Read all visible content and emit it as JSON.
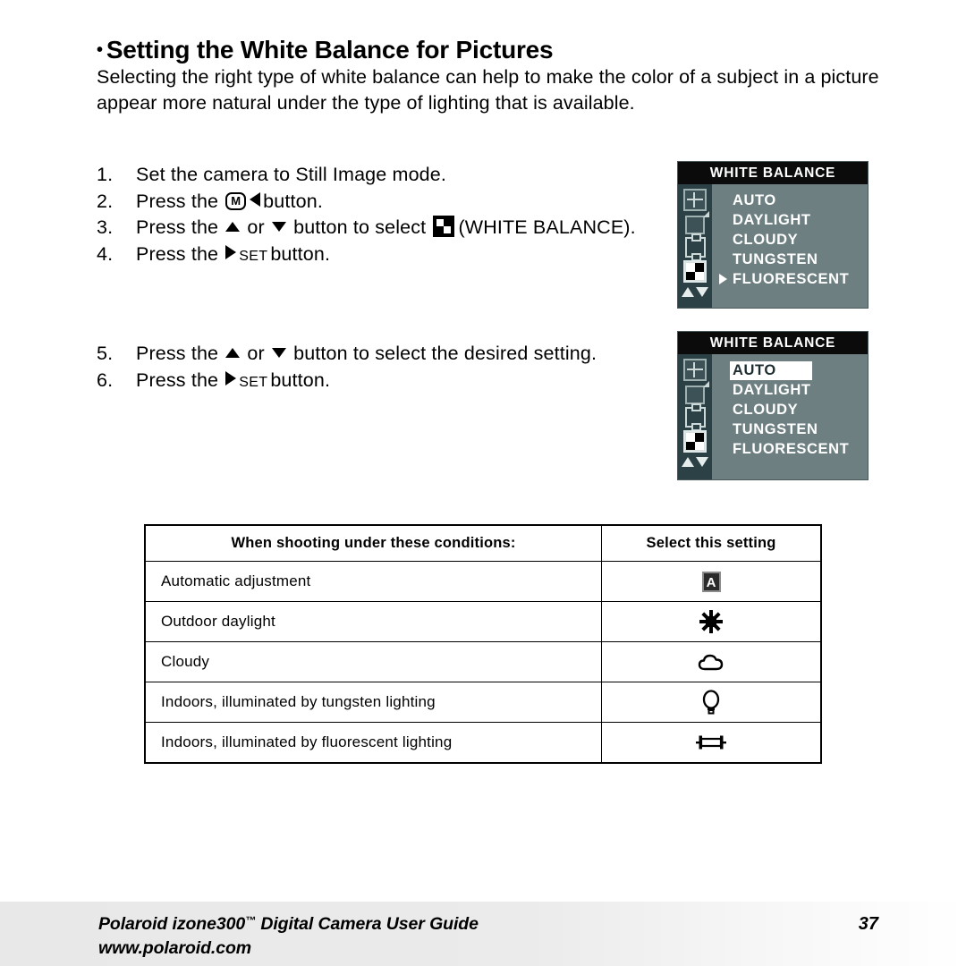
{
  "heading": {
    "bullet": "•",
    "text": "Setting the White Balance for Pictures"
  },
  "intro": "Selecting the right type of white balance can help to make the color of a subject in a picture appear more natural under the type of lighting that is available.",
  "steps_group_a": [
    {
      "num": "1.",
      "parts": [
        {
          "type": "text",
          "text": "Set the camera to Still Image mode."
        }
      ]
    },
    {
      "num": "2.",
      "parts": [
        {
          "type": "text",
          "text": "Press the "
        },
        {
          "type": "btn-m",
          "text": "M"
        },
        {
          "type": "tri-left"
        },
        {
          "type": "text",
          "text": "button."
        }
      ]
    },
    {
      "num": "3.",
      "parts": [
        {
          "type": "text",
          "text": "Press the "
        },
        {
          "type": "tri-up"
        },
        {
          "type": "text",
          "text": " or "
        },
        {
          "type": "tri-down"
        },
        {
          "type": "text",
          "text": " button to select "
        },
        {
          "type": "wb-icon"
        },
        {
          "type": "text",
          "text": "(WHITE BALANCE)."
        }
      ]
    },
    {
      "num": "4.",
      "parts": [
        {
          "type": "text",
          "text": "Press the "
        },
        {
          "type": "tri-right"
        },
        {
          "type": "set",
          "text": "SET"
        },
        {
          "type": "text",
          "text": "button."
        }
      ]
    }
  ],
  "steps_group_b": [
    {
      "num": "5.",
      "parts": [
        {
          "type": "text",
          "text": "Press the "
        },
        {
          "type": "tri-up"
        },
        {
          "type": "text",
          "text": " or "
        },
        {
          "type": "tri-down"
        },
        {
          "type": "text",
          "text": " button to select the desired setting."
        }
      ]
    },
    {
      "num": "6.",
      "parts": [
        {
          "type": "text",
          "text": "Press the "
        },
        {
          "type": "tri-right"
        },
        {
          "type": "set",
          "text": "SET"
        },
        {
          "type": "text",
          "text": "button."
        }
      ]
    }
  ],
  "lcd_screens": [
    {
      "title": "WHITE BALANCE",
      "options": [
        {
          "label": "AUTO",
          "cursor": false,
          "highlighted": false
        },
        {
          "label": "DAYLIGHT",
          "cursor": false,
          "highlighted": false
        },
        {
          "label": "CLOUDY",
          "cursor": false,
          "highlighted": false
        },
        {
          "label": "TUNGSTEN",
          "cursor": false,
          "highlighted": false
        },
        {
          "label": "FLUORESCENT",
          "cursor": true,
          "highlighted": false
        }
      ],
      "rail_icons": [
        "resolution-icon",
        "quality-icon",
        "effect-icon",
        "white-balance-icon"
      ],
      "selected_rail_icon": "white-balance-icon"
    },
    {
      "title": "WHITE BALANCE",
      "options": [
        {
          "label": "AUTO",
          "cursor": false,
          "highlighted": true
        },
        {
          "label": "DAYLIGHT",
          "cursor": false,
          "highlighted": false
        },
        {
          "label": "CLOUDY",
          "cursor": false,
          "highlighted": false
        },
        {
          "label": "TUNGSTEN",
          "cursor": false,
          "highlighted": false
        },
        {
          "label": "FLUORESCENT",
          "cursor": false,
          "highlighted": false
        }
      ],
      "rail_icons": [
        "resolution-icon",
        "quality-icon",
        "effect-icon",
        "white-balance-icon"
      ],
      "selected_rail_icon": "white-balance-icon"
    }
  ],
  "table": {
    "headers": [
      "When shooting under these conditions:",
      "Select this setting"
    ],
    "rows": [
      {
        "condition": "Automatic adjustment",
        "icon": "auto-a-icon",
        "icon_label": "A"
      },
      {
        "condition": "Outdoor daylight",
        "icon": "sun-icon",
        "icon_label": ""
      },
      {
        "condition": "Cloudy",
        "icon": "cloud-icon",
        "icon_label": ""
      },
      {
        "condition": "Indoors, illuminated by tungsten lighting",
        "icon": "light-bulb-icon",
        "icon_label": ""
      },
      {
        "condition": "Indoors, illuminated by fluorescent lighting",
        "icon": "fluorescent-tube-icon",
        "icon_label": ""
      }
    ]
  },
  "footer": {
    "product_line": "Polaroid izone300",
    "trademark": "™",
    "product_line_rest": " Digital Camera User Guide",
    "website": "www.polaroid.com",
    "page_number": "37"
  },
  "colors": {
    "lcd_background": "#6d7f81",
    "lcd_rail": "#2b4145",
    "lcd_title_bar": "#0b0b0b",
    "text": "#000000",
    "footer_band": "#e8e8e8"
  }
}
